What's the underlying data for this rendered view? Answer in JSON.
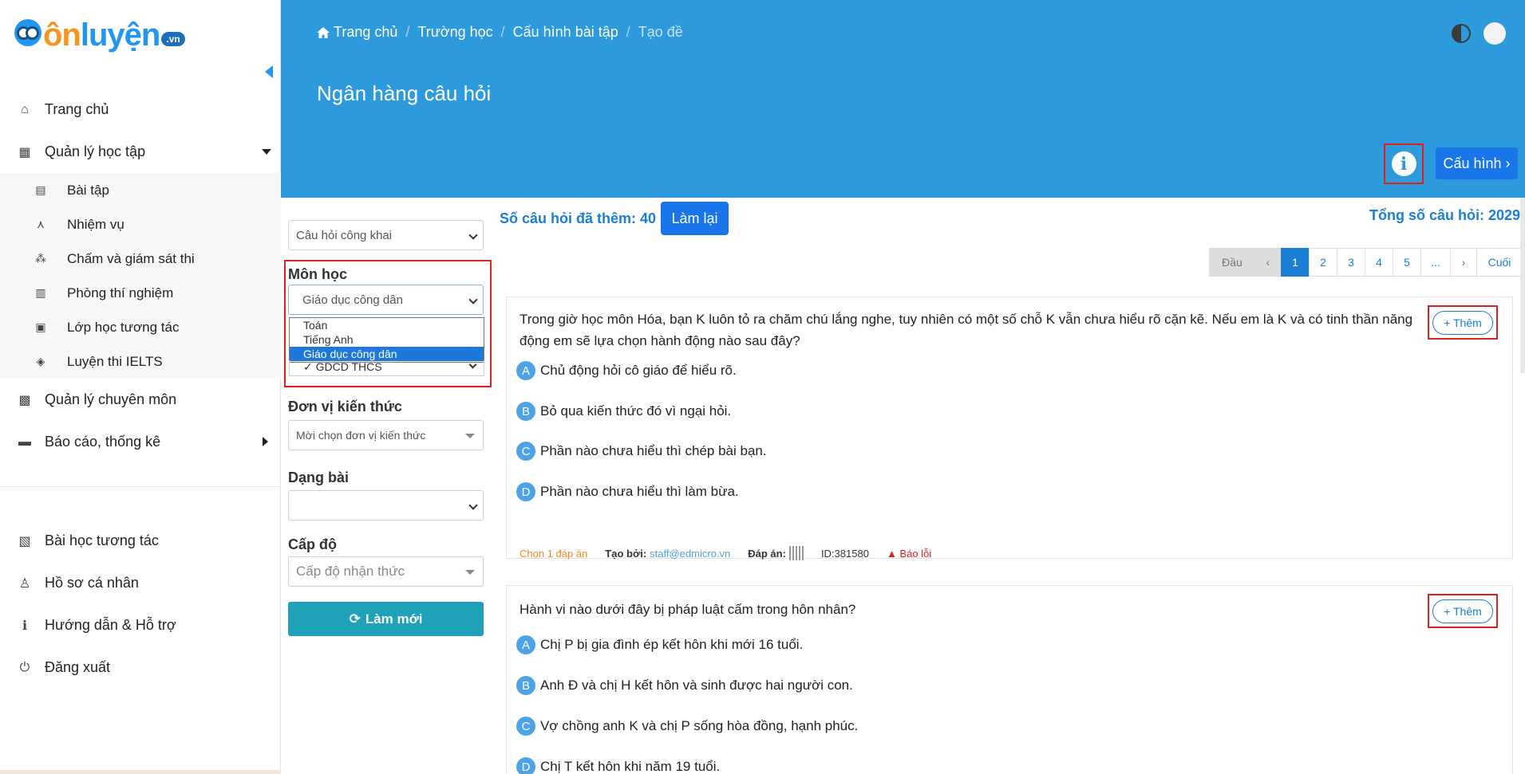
{
  "logo": {
    "text_left": "ôn",
    "text_right": "luyện",
    "badge": ".vn"
  },
  "sidebar": {
    "items": [
      {
        "label": "Trang chủ",
        "icon": "home-icon"
      },
      {
        "label": "Quản lý học tập",
        "icon": "school-icon"
      }
    ],
    "subitems": [
      {
        "label": "Bài tập",
        "icon": "homework-icon"
      },
      {
        "label": "Nhiệm vụ",
        "icon": "compass-icon"
      },
      {
        "label": "Chấm và giám sát thi",
        "icon": "exam-icon"
      },
      {
        "label": "Phòng thí nghiệm",
        "icon": "lab-icon"
      },
      {
        "label": "Lớp học tương tác",
        "icon": "interactive-class-icon"
      },
      {
        "label": "Luyện thi IELTS",
        "icon": "graduation-cap-icon"
      }
    ],
    "items2": [
      {
        "label": "Quản lý chuyên môn",
        "icon": "calendar-icon"
      },
      {
        "label": "Báo cáo, thống kê",
        "icon": "report-icon"
      }
    ],
    "bottom_items": [
      {
        "label": "Bài học tương tác",
        "icon": "lesson-icon"
      },
      {
        "label": "Hồ sơ cá nhân",
        "icon": "user-icon"
      },
      {
        "label": "Hướng dẫn & Hỗ trợ",
        "icon": "help-icon"
      },
      {
        "label": "Đăng xuất",
        "icon": "power-icon"
      }
    ]
  },
  "breadcrumb": [
    "Trang chủ",
    "Trường học",
    "Cấu hình bài tập",
    "Tạo đề"
  ],
  "page_title": "Ngân hàng câu hỏi",
  "header": {
    "config_button": "Cấu hình ›",
    "info": "i"
  },
  "filters": {
    "scope_select": "Câu hỏi công khai",
    "subject_label": "Môn học",
    "subject_value": "Giáo dục công dân",
    "subject_options": [
      "Toán",
      "Tiếng Anh",
      "Giáo dục công dân"
    ],
    "grade_value": "✓ GDCD THCS",
    "unit_label": "Đơn vị kiến thức",
    "unit_placeholder": "Mời chọn đơn vị kiến thức",
    "type_label": "Dạng bài",
    "level_label": "Cấp độ",
    "level_placeholder": "Cấp độ nhận thức",
    "refresh_button": "Làm mới"
  },
  "summary": {
    "added": "Số câu hỏi đã thêm: 40",
    "reset_button": "Làm lại",
    "total": "Tổng số câu hỏi: 2029"
  },
  "pager": [
    "Đầu",
    "‹",
    "1",
    "2",
    "3",
    "4",
    "5",
    "...",
    "›",
    "Cuối"
  ],
  "questions": [
    {
      "text": "Trong giờ học môn Hóa, bạn K luôn tỏ ra chăm chú lắng nghe, tuy nhiên có một số chỗ K vẫn chưa hiểu rõ cặn kẽ. Nếu em là K và có tinh thần năng động em sẽ lựa chọn hành động nào sau đây?",
      "answers": [
        {
          "key": "A",
          "text": "Chủ động hỏi cô giáo để hiểu rõ."
        },
        {
          "key": "B",
          "text": "Bỏ qua kiến thức đó vì ngại hỏi."
        },
        {
          "key": "C",
          "text": "Phần nào chưa hiểu thì chép bài bạn."
        },
        {
          "key": "D",
          "text": "Phần nào chưa hiểu thì làm bừa."
        }
      ],
      "add_label": "+ Thêm",
      "meta": {
        "type": "Chọn 1 đáp án",
        "creator_label": "Tạo bởi:",
        "creator": "staff@edmicro.vn",
        "answer_label": "Đáp án:",
        "id": "ID:381580",
        "report": "Báo lỗi"
      }
    },
    {
      "text": "Hành vi nào dưới đây bị pháp luật cấm trong hôn nhân?",
      "answers": [
        {
          "key": "A",
          "text": "Chị P bị gia đình ép kết hôn khi mới 16 tuổi."
        },
        {
          "key": "B",
          "text": "Anh Đ và chị H kết hôn và sinh được hai người con."
        },
        {
          "key": "C",
          "text": "Vợ chồng anh K và chị P sống hòa đồng, hạnh phúc."
        },
        {
          "key": "D",
          "text": "Chị T kết hôn khi năm 19 tuổi."
        }
      ],
      "add_label": "+ Thêm"
    }
  ],
  "colors": {
    "header": "#2d9adc",
    "primary": "#1976e8",
    "teal": "#1fa2b7",
    "highlight": "#e02020"
  }
}
